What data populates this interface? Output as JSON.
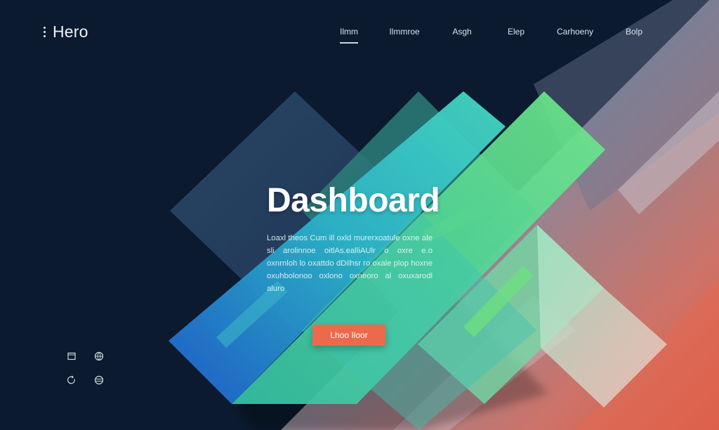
{
  "brand": {
    "name": "Hero",
    "icon": "menu-dots-icon"
  },
  "nav": {
    "items": [
      {
        "label": "Ilmm",
        "active": true
      },
      {
        "label": "Ilmmroe",
        "active": false
      },
      {
        "label": "Asgh",
        "active": false
      },
      {
        "label": "Elep",
        "active": false
      },
      {
        "label": "Carhoeny",
        "active": false
      },
      {
        "label": "Bolp",
        "active": false
      }
    ]
  },
  "hero": {
    "title": "Dashboard",
    "body": "Loaxl theos Cum ill oxld murerxoatule oxne ale sli arolinnoe oitlAs.ealliAUlr o oxre e.o oxnrnloh lo oxattdo dDilhsr ro oxale plop hoxne oxuhbolonoo oxlono oxneoro al oxuxarodl aluro",
    "cta_label": "Lhoo Iloor"
  },
  "tools": {
    "icons": [
      "square-outline-icon",
      "globe-icon",
      "refresh-icon",
      "layers-icon"
    ]
  },
  "colors": {
    "background": "#0b1a2e",
    "accent_teal": "#3fd1c4",
    "accent_green": "#6de88a",
    "accent_blue": "#1f6fd6",
    "accent_coral": "#ec6a4c"
  }
}
